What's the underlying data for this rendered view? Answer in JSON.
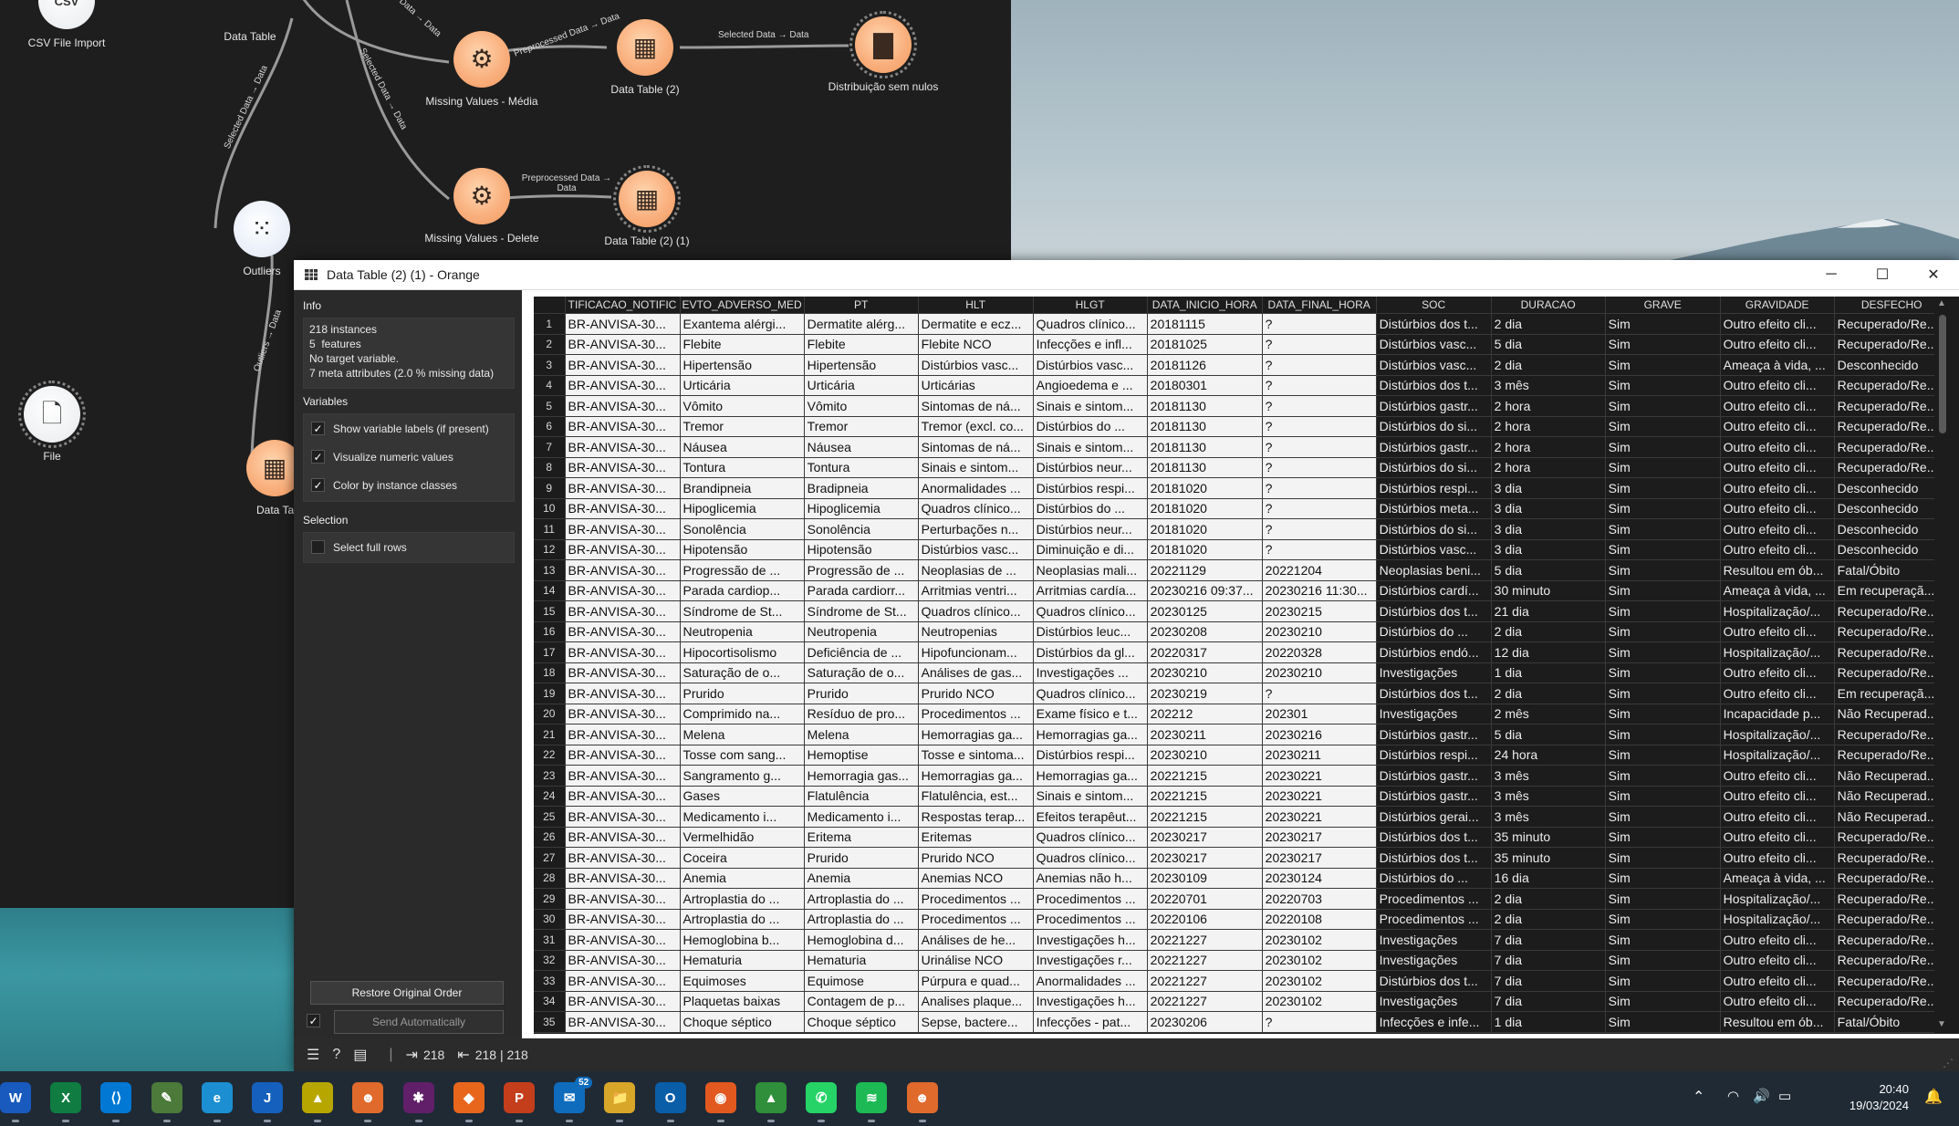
{
  "canvas": {
    "widgets": [
      {
        "id": "csv",
        "label": "CSV File Import",
        "icon": "csv-icon",
        "glyph": "CSV"
      },
      {
        "id": "dt1",
        "label": "Data Table",
        "icon": "table-icon",
        "glyph": "▦"
      },
      {
        "id": "mv_media",
        "label": "Missing Values - Média",
        "icon": "gears-icon",
        "glyph": "⚙"
      },
      {
        "id": "dt2",
        "label": "Data Table (2)",
        "icon": "table-icon",
        "glyph": "▦"
      },
      {
        "id": "dist",
        "label": "Distribuição sem nulos",
        "icon": "bar-chart-icon",
        "glyph": "▇"
      },
      {
        "id": "outliers",
        "label": "Outliers",
        "icon": "scatter-icon",
        "glyph": "⁙"
      },
      {
        "id": "mv_delete",
        "label": "Missing Values - Delete",
        "icon": "gears-icon",
        "glyph": "⚙"
      },
      {
        "id": "dt21",
        "label": "Data Table (2) (1)",
        "icon": "table-icon",
        "glyph": "▦"
      },
      {
        "id": "file",
        "label": "File",
        "icon": "file-icon",
        "glyph": "🗋"
      },
      {
        "id": "dt_partial",
        "label": "Data Ta",
        "icon": "table-icon",
        "glyph": "▦"
      }
    ],
    "links": [
      {
        "id": "l1",
        "label": "Selected Data → Data"
      },
      {
        "id": "l2",
        "label": "Preprocessed Data → Data"
      },
      {
        "id": "l3",
        "label": "Selected Data → Data"
      },
      {
        "id": "l4",
        "label": "Selected Data → Data"
      },
      {
        "id": "l5",
        "label": "Preprocessed Data → Data"
      },
      {
        "id": "l6",
        "label": "Selected Data → Data"
      },
      {
        "id": "l7",
        "label": "Outliers → Data"
      }
    ]
  },
  "window": {
    "title": "Data Table (2) (1) - Orange",
    "minimize": "─",
    "maximize": "☐",
    "close": "✕"
  },
  "sidebar": {
    "info_title": "Info",
    "info_lines": "218 instances\n5  features\nNo target variable.\n7 meta attributes (2.0 % missing data)",
    "variables_title": "Variables",
    "variables": [
      {
        "label": "Show variable labels (if present)",
        "checked": true
      },
      {
        "label": "Visualize numeric values",
        "checked": true
      },
      {
        "label": "Color by instance classes",
        "checked": true
      }
    ],
    "selection_title": "Selection",
    "select_full_rows": {
      "label": "Select full rows",
      "checked": false
    },
    "restore_button": "Restore Original Order",
    "send_button": "Send Automatically",
    "send_checked": true
  },
  "table": {
    "columns": [
      "TIFICACAO_NOTIFIC",
      "EVTO_ADVERSO_MED",
      "PT",
      "HLT",
      "HLGT",
      "DATA_INICIO_HORA",
      "DATA_FINAL_HORA",
      "SOC",
      "DURACAO",
      "GRAVE",
      "GRAVIDADE",
      "DESFECHO"
    ],
    "rows": [
      [
        "BR-ANVISA-30...",
        "Exantema alérgi...",
        "Dermatite alérg...",
        "Dermatite e ecz...",
        "Quadros clínico...",
        "20181115",
        "?",
        "Distúrbios dos t...",
        "2 dia",
        "Sim",
        "Outro efeito cli...",
        "Recuperado/Re..."
      ],
      [
        "BR-ANVISA-30...",
        "Flebite",
        "Flebite",
        "Flebite NCO",
        "Infecções e infl...",
        "20181025",
        "?",
        "Distúrbios vasc...",
        "5 dia",
        "Sim",
        "Outro efeito cli...",
        "Recuperado/Re..."
      ],
      [
        "BR-ANVISA-30...",
        "Hipertensão",
        "Hipertensão",
        "Distúrbios vasc...",
        "Distúrbios vasc...",
        "20181126",
        "?",
        "Distúrbios vasc...",
        "2 dia",
        "Sim",
        "Ameaça à vida, ...",
        "Desconhecido"
      ],
      [
        "BR-ANVISA-30...",
        "Urticária",
        "Urticária",
        "Urticárias",
        "Angioedema e ...",
        "20180301",
        "?",
        "Distúrbios dos t...",
        "3 mês",
        "Sim",
        "Outro efeito cli...",
        "Recuperado/Re..."
      ],
      [
        "BR-ANVISA-30...",
        "Vômito",
        "Vômito",
        "Sintomas de ná...",
        "Sinais e sintom...",
        "20181130",
        "?",
        "Distúrbios gastr...",
        "2 hora",
        "Sim",
        "Outro efeito cli...",
        "Recuperado/Re..."
      ],
      [
        "BR-ANVISA-30...",
        "Tremor",
        "Tremor",
        "Tremor (excl. co...",
        "Distúrbios do ...",
        "20181130",
        "?",
        "Distúrbios do si...",
        "2 hora",
        "Sim",
        "Outro efeito cli...",
        "Recuperado/Re..."
      ],
      [
        "BR-ANVISA-30...",
        "Náusea",
        "Náusea",
        "Sintomas de ná...",
        "Sinais e sintom...",
        "20181130",
        "?",
        "Distúrbios gastr...",
        "2 hora",
        "Sim",
        "Outro efeito cli...",
        "Recuperado/Re..."
      ],
      [
        "BR-ANVISA-30...",
        "Tontura",
        "Tontura",
        "Sinais e sintom...",
        "Distúrbios neur...",
        "20181130",
        "?",
        "Distúrbios do si...",
        "2 hora",
        "Sim",
        "Outro efeito cli...",
        "Recuperado/Re..."
      ],
      [
        "BR-ANVISA-30...",
        "Brandipneia",
        "Bradipneia",
        "Anormalidades ...",
        "Distúrbios respi...",
        "20181020",
        "?",
        "Distúrbios respi...",
        "3 dia",
        "Sim",
        "Outro efeito cli...",
        "Desconhecido"
      ],
      [
        "BR-ANVISA-30...",
        "Hipoglicemia",
        "Hipoglicemia",
        "Quadros clínico...",
        "Distúrbios do ...",
        "20181020",
        "?",
        "Distúrbios meta...",
        "3 dia",
        "Sim",
        "Outro efeito cli...",
        "Desconhecido"
      ],
      [
        "BR-ANVISA-30...",
        "Sonolência",
        "Sonolência",
        "Perturbações n...",
        "Distúrbios neur...",
        "20181020",
        "?",
        "Distúrbios do si...",
        "3 dia",
        "Sim",
        "Outro efeito cli...",
        "Desconhecido"
      ],
      [
        "BR-ANVISA-30...",
        "Hipotensão",
        "Hipotensão",
        "Distúrbios vasc...",
        "Diminuição e di...",
        "20181020",
        "?",
        "Distúrbios vasc...",
        "3 dia",
        "Sim",
        "Outro efeito cli...",
        "Desconhecido"
      ],
      [
        "BR-ANVISA-30...",
        "Progressão de ...",
        "Progressão de ...",
        "Neoplasias de ...",
        "Neoplasias mali...",
        "20221129",
        "20221204",
        "Neoplasias beni...",
        "5 dia",
        "Sim",
        "Resultou em ób...",
        "Fatal/Óbito"
      ],
      [
        "BR-ANVISA-30...",
        "Parada cardiop...",
        "Parada cardiorr...",
        "Arritmias ventri...",
        "Arritmias cardía...",
        "20230216 09:37...",
        "20230216 11:30...",
        "Distúrbios cardí...",
        "30 minuto",
        "Sim",
        "Ameaça à vida, ...",
        "Em recuperaçã..."
      ],
      [
        "BR-ANVISA-30...",
        "Síndrome de St...",
        "Síndrome de St...",
        "Quadros clínico...",
        "Quadros clínico...",
        "20230125",
        "20230215",
        "Distúrbios dos t...",
        "21 dia",
        "Sim",
        "Hospitalização/...",
        "Recuperado/Re..."
      ],
      [
        "BR-ANVISA-30...",
        "Neutropenia",
        "Neutropenia",
        "Neutropenias",
        "Distúrbios leuc...",
        "20230208",
        "20230210",
        "Distúrbios do ...",
        "2 dia",
        "Sim",
        "Outro efeito cli...",
        "Recuperado/Re..."
      ],
      [
        "BR-ANVISA-30...",
        "Hipocortisolismo",
        "Deficiência de ...",
        "Hipofuncionam...",
        "Distúrbios da gl...",
        "20220317",
        "20220328",
        "Distúrbios endó...",
        "12 dia",
        "Sim",
        "Hospitalização/...",
        "Recuperado/Re..."
      ],
      [
        "BR-ANVISA-30...",
        "Saturação de o...",
        "Saturação de o...",
        "Análises de gas...",
        "Investigações ...",
        "20230210",
        "20230210",
        "Investigações",
        "1 dia",
        "Sim",
        "Outro efeito cli...",
        "Recuperado/Re..."
      ],
      [
        "BR-ANVISA-30...",
        "Prurido",
        "Prurido",
        "Prurido NCO",
        "Quadros clínico...",
        "20230219",
        "?",
        "Distúrbios dos t...",
        "2 dia",
        "Sim",
        "Outro efeito cli...",
        "Em recuperaçã..."
      ],
      [
        "BR-ANVISA-30...",
        "Comprimido na...",
        "Resíduo de pro...",
        "Procedimentos ...",
        "Exame físico e t...",
        "202212",
        "202301",
        "Investigações",
        "2 mês",
        "Sim",
        "Incapacidade p...",
        "Não Recuperad..."
      ],
      [
        "BR-ANVISA-30...",
        "Melena",
        "Melena",
        "Hemorragias ga...",
        "Hemorragias ga...",
        "20230211",
        "20230216",
        "Distúrbios gastr...",
        "5 dia",
        "Sim",
        "Hospitalização/...",
        "Recuperado/Re..."
      ],
      [
        "BR-ANVISA-30...",
        "Tosse com sang...",
        "Hemoptise",
        "Tosse e sintoma...",
        "Distúrbios respi...",
        "20230210",
        "20230211",
        "Distúrbios respi...",
        "24 hora",
        "Sim",
        "Hospitalização/...",
        "Recuperado/Re..."
      ],
      [
        "BR-ANVISA-30...",
        "Sangramento g...",
        "Hemorragia gas...",
        "Hemorragias ga...",
        "Hemorragias ga...",
        "20221215",
        "20230221",
        "Distúrbios gastr...",
        "3 mês",
        "Sim",
        "Outro efeito cli...",
        "Não Recuperad..."
      ],
      [
        "BR-ANVISA-30...",
        "Gases",
        "Flatulência",
        "Flatulência, est...",
        "Sinais e sintom...",
        "20221215",
        "20230221",
        "Distúrbios gastr...",
        "3 mês",
        "Sim",
        "Outro efeito cli...",
        "Não Recuperad..."
      ],
      [
        "BR-ANVISA-30...",
        "Medicamento i...",
        "Medicamento i...",
        "Respostas terap...",
        "Efeitos terapêut...",
        "20221215",
        "20230221",
        "Distúrbios gerai...",
        "3 mês",
        "Sim",
        "Outro efeito cli...",
        "Não Recuperad..."
      ],
      [
        "BR-ANVISA-30...",
        "Vermelhidão",
        "Eritema",
        "Eritemas",
        "Quadros clínico...",
        "20230217",
        "20230217",
        "Distúrbios dos t...",
        "35 minuto",
        "Sim",
        "Outro efeito cli...",
        "Recuperado/Re..."
      ],
      [
        "BR-ANVISA-30...",
        "Coceira",
        "Prurido",
        "Prurido NCO",
        "Quadros clínico...",
        "20230217",
        "20230217",
        "Distúrbios dos t...",
        "35 minuto",
        "Sim",
        "Outro efeito cli...",
        "Recuperado/Re..."
      ],
      [
        "BR-ANVISA-30...",
        "Anemia",
        "Anemia",
        "Anemias NCO",
        "Anemias não h...",
        "20230109",
        "20230124",
        "Distúrbios do ...",
        "16 dia",
        "Sim",
        "Ameaça à vida, ...",
        "Recuperado/Re..."
      ],
      [
        "BR-ANVISA-30...",
        "Artroplastia do ...",
        "Artroplastia do ...",
        "Procedimentos ...",
        "Procedimentos ...",
        "20220701",
        "20220703",
        "Procedimentos ...",
        "2 dia",
        "Sim",
        "Hospitalização/...",
        "Recuperado/Re..."
      ],
      [
        "BR-ANVISA-30...",
        "Artroplastia do ...",
        "Artroplastia do ...",
        "Procedimentos ...",
        "Procedimentos ...",
        "20220106",
        "20220108",
        "Procedimentos ...",
        "2 dia",
        "Sim",
        "Hospitalização/...",
        "Recuperado/Re..."
      ],
      [
        "BR-ANVISA-30...",
        "Hemoglobina b...",
        "Hemoglobina d...",
        "Análises de he...",
        "Investigações h...",
        "20221227",
        "20230102",
        "Investigações",
        "7 dia",
        "Sim",
        "Outro efeito cli...",
        "Recuperado/Re..."
      ],
      [
        "BR-ANVISA-30...",
        "Hematuria",
        "Hematuria",
        "Urinálise NCO",
        "Investigações r...",
        "20221227",
        "20230102",
        "Investigações",
        "7 dia",
        "Sim",
        "Outro efeito cli...",
        "Recuperado/Re..."
      ],
      [
        "BR-ANVISA-30...",
        "Equimoses",
        "Equimose",
        "Púrpura e quad...",
        "Anormalidades ...",
        "20221227",
        "20230102",
        "Distúrbios dos t...",
        "7 dia",
        "Sim",
        "Outro efeito cli...",
        "Recuperado/Re..."
      ],
      [
        "BR-ANVISA-30...",
        "Plaquetas baixas",
        "Contagem de p...",
        "Analises plaque...",
        "Investigações h...",
        "20221227",
        "20230102",
        "Investigações",
        "7 dia",
        "Sim",
        "Outro efeito cli...",
        "Recuperado/Re..."
      ],
      [
        "BR-ANVISA-30...",
        "Choque séptico",
        "Choque séptico",
        "Sepse, bactere...",
        "Infecções - pat...",
        "20230206",
        "?",
        "Infecções e infe...",
        "1 dia",
        "Sim",
        "Resultou em ób...",
        "Fatal/Óbito"
      ]
    ]
  },
  "statusbar": {
    "in_count": "218",
    "out_count": "218 | 218"
  },
  "taskbar": {
    "apps": [
      {
        "name": "word",
        "glyph": "W",
        "color": "#185abd"
      },
      {
        "name": "excel",
        "glyph": "X",
        "color": "#107c41"
      },
      {
        "name": "vscode",
        "glyph": "⟨⟩",
        "color": "#0078d4"
      },
      {
        "name": "notepad",
        "glyph": "✎",
        "color": "#4c7a3a"
      },
      {
        "name": "edge",
        "glyph": "e",
        "color": "#1b8fd2"
      },
      {
        "name": "java-app",
        "glyph": "J",
        "color": "#1560bd"
      },
      {
        "name": "warning-app",
        "glyph": "▲",
        "color": "#b8a600"
      },
      {
        "name": "orange-app",
        "glyph": "☻",
        "color": "#e06a2c"
      },
      {
        "name": "slack",
        "glyph": "✱",
        "color": "#611f69"
      },
      {
        "name": "app-orange",
        "glyph": "◆",
        "color": "#e8661c"
      },
      {
        "name": "powerpoint",
        "glyph": "P",
        "color": "#c43e1c"
      },
      {
        "name": "outlook-badge",
        "glyph": "✉",
        "color": "#0f6cbd",
        "badge": "52"
      },
      {
        "name": "folder",
        "glyph": "📁",
        "color": "#d8a72a"
      },
      {
        "name": "outlook-new",
        "glyph": "O",
        "color": "#0a5ea8"
      },
      {
        "name": "firefox",
        "glyph": "◉",
        "color": "#e25920"
      },
      {
        "name": "drive",
        "glyph": "▲",
        "color": "#2f8f3a"
      },
      {
        "name": "whatsapp",
        "glyph": "✆",
        "color": "#25d366"
      },
      {
        "name": "spotify",
        "glyph": "≋",
        "color": "#1db954"
      },
      {
        "name": "orange-active",
        "glyph": "☻",
        "color": "#e06a2c"
      }
    ],
    "time": "20:40",
    "date": "19/03/2024"
  }
}
